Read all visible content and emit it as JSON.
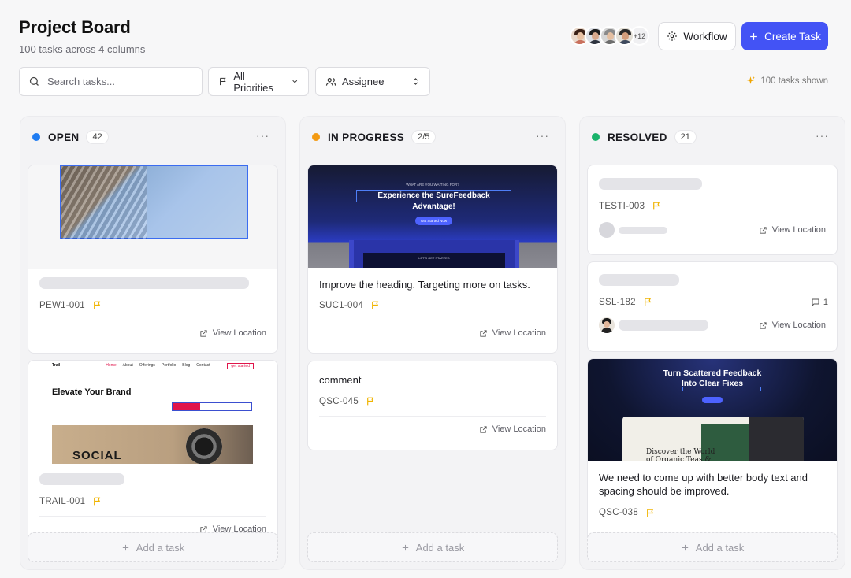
{
  "header": {
    "title": "Project Board",
    "subtitle": "100 tasks across 4 columns",
    "avatars_more": "+12",
    "workflow_label": "Workflow",
    "create_label": "Create Task"
  },
  "toolbar": {
    "search_placeholder": "Search tasks...",
    "priority_label": "All Priorities",
    "assignee_label": "Assignee",
    "shown_label": "100 tasks shown"
  },
  "colors": {
    "accent": "#4353f5",
    "open": "#1f7cf2",
    "in_progress": "#f39a12",
    "resolved": "#19b36b",
    "flag": "#f0b400"
  },
  "columns": [
    {
      "title": "OPEN",
      "count": "42",
      "cards": [
        {
          "id": "PEW1-001"
        },
        {
          "id": "TRAIL-001",
          "image_text": {
            "brand": "Trail",
            "headline": "Elevate Your Brand",
            "photo_word": "SOCIAL",
            "nav": [
              "Home",
              "About",
              "Offerings",
              "Portfolio",
              "Blog",
              "Contact"
            ],
            "cta": "get started"
          }
        }
      ]
    },
    {
      "title": "IN PROGRESS",
      "count": "2/5",
      "cards": [
        {
          "id": "SUC1-004",
          "text": "Improve the heading. Targeting more on tasks.",
          "image_text": {
            "eyebrow": "WHAT ARE YOU WAITING FOR?",
            "headline": "Experience the SureFeedback Advantage!",
            "button": "Get Started Now",
            "footer": "LET'S GET STARTED"
          }
        },
        {
          "id": "QSC-045",
          "text": "comment"
        }
      ]
    },
    {
      "title": "RESOLVED",
      "count": "21",
      "cards": [
        {
          "id": "TESTI-003"
        },
        {
          "id": "SSL-182",
          "comments": "1"
        },
        {
          "id": "QSC-038",
          "text": "We need to come up with better body text and spacing should be improved.",
          "image_text": {
            "headline": "Turn Scattered Feedback Into Clear Fixes",
            "app_heading": "Discover the World of Organic Teas & Coffee"
          }
        }
      ]
    }
  ],
  "common": {
    "view_location": "View Location",
    "add_task": "Add a task",
    "more": "···"
  }
}
